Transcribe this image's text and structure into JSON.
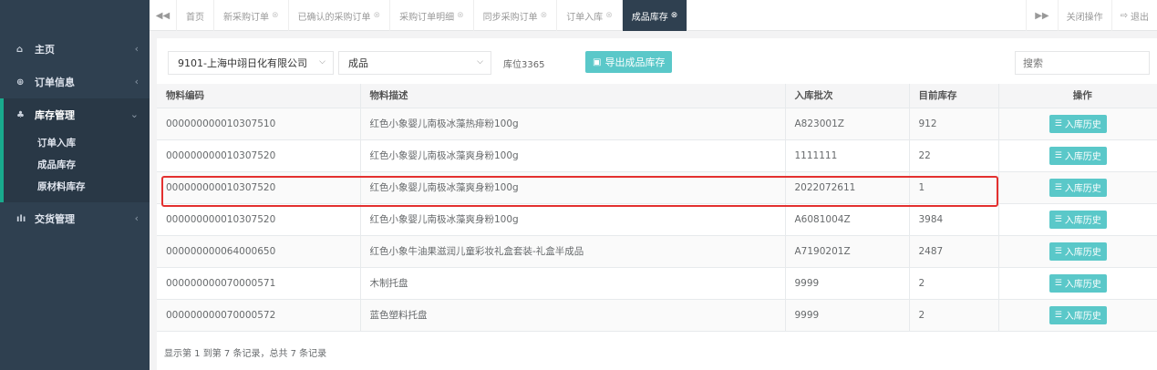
{
  "sidebar": {
    "items": [
      {
        "label": "主页",
        "icon": "home-icon",
        "glyph": "⌂"
      },
      {
        "label": "订单信息",
        "icon": "order-info-icon",
        "glyph": "⊕"
      },
      {
        "label": "库存管理",
        "icon": "inventory-icon",
        "glyph": "♣"
      },
      {
        "label": "交货管理",
        "icon": "bar-chart-icon",
        "glyph": "ılı"
      }
    ],
    "sub_items": [
      "订单入库",
      "成品库存",
      "原材料库存"
    ],
    "chevron_collapsed": "‹",
    "chevron_expanded": "⌄"
  },
  "tabbar": {
    "scroll_left": "◀◀",
    "tabs": [
      {
        "label": "首页",
        "closable": false
      },
      {
        "label": "新采购订单",
        "closable": true
      },
      {
        "label": "已确认的采购订单",
        "closable": true
      },
      {
        "label": "采购订单明细",
        "closable": true
      },
      {
        "label": "同步采购订单",
        "closable": true
      },
      {
        "label": "订单入库",
        "closable": true
      },
      {
        "label": "成品库存",
        "closable": true,
        "active": true
      }
    ],
    "close_glyph": "⊗",
    "scroll_right": "▶▶",
    "close_ops": "关闭操作",
    "logout": "退出",
    "logout_glyph": "⇨"
  },
  "toolbar": {
    "company_select": "9101-上海中翊日化有限公司",
    "type_select": "成品",
    "location_label": "库位3365",
    "export_label": "导出成品库存",
    "search_placeholder": "搜索"
  },
  "table": {
    "columns": [
      "物料编码",
      "物料描述",
      "入库批次",
      "目前库存",
      "操作"
    ],
    "action_label": "入库历史",
    "rows": [
      [
        "000000000010307510",
        "红色小象婴儿南极冰藻热痱粉100g",
        "A823001Z",
        "912"
      ],
      [
        "000000000010307520",
        "红色小象婴儿南极冰藻爽身粉100g",
        "1111111",
        "22"
      ],
      [
        "000000000010307520",
        "红色小象婴儿南极冰藻爽身粉100g",
        "2022072611",
        "1"
      ],
      [
        "000000000010307520",
        "红色小象婴儿南极冰藻爽身粉100g",
        "A6081004Z",
        "3984"
      ],
      [
        "000000000064000650",
        "红色小象牛油果滋润儿童彩妆礼盒套装-礼盒半成品",
        "A7190201Z",
        "2487"
      ],
      [
        "000000000070000571",
        "木制托盘",
        "9999",
        "2"
      ],
      [
        "000000000070000572",
        "蓝色塑料托盘",
        "9999",
        "2"
      ]
    ]
  },
  "footer": {
    "summary": "显示第 1 到第 7 条记录，总共 7 条记录"
  },
  "colors": {
    "sidebar_bg": "#2f4050",
    "accent": "#19aa8d",
    "button": "#5ac8c9",
    "highlight": "#e3302f"
  }
}
